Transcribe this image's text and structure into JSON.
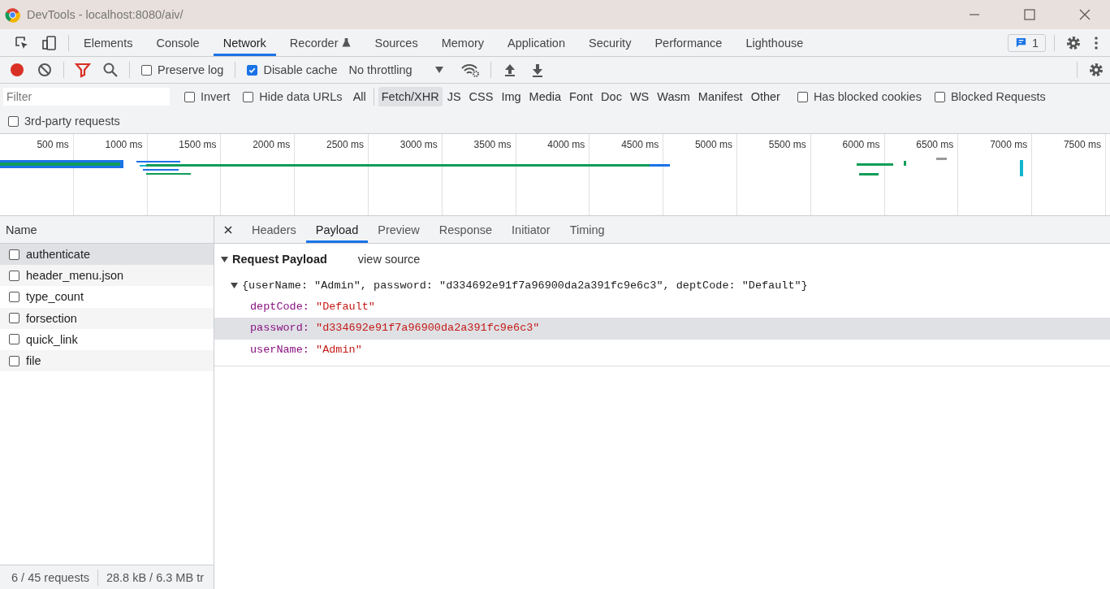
{
  "window": {
    "title": "DevTools - localhost:8080/aiv/"
  },
  "main_tabs": [
    {
      "label": "Elements",
      "selected": false,
      "experimental": false
    },
    {
      "label": "Console",
      "selected": false,
      "experimental": false
    },
    {
      "label": "Network",
      "selected": true,
      "experimental": false
    },
    {
      "label": "Recorder",
      "selected": false,
      "experimental": true
    },
    {
      "label": "Sources",
      "selected": false,
      "experimental": false
    },
    {
      "label": "Memory",
      "selected": false,
      "experimental": false
    },
    {
      "label": "Application",
      "selected": false,
      "experimental": false
    },
    {
      "label": "Security",
      "selected": false,
      "experimental": false
    },
    {
      "label": "Performance",
      "selected": false,
      "experimental": false
    },
    {
      "label": "Lighthouse",
      "selected": false,
      "experimental": false
    }
  ],
  "issues_badge": "1",
  "toolbar": {
    "recording": true,
    "preserve_log": {
      "label": "Preserve log",
      "checked": false
    },
    "disable_cache": {
      "label": "Disable cache",
      "checked": true
    },
    "throttling": "No throttling"
  },
  "filter": {
    "placeholder": "Filter",
    "invert": {
      "label": "Invert",
      "checked": false
    },
    "hide_data_urls": {
      "label": "Hide data URLs",
      "checked": false
    },
    "types": [
      {
        "label": "All",
        "selected": false
      },
      {
        "label": "Fetch/XHR",
        "selected": true
      },
      {
        "label": "JS",
        "selected": false
      },
      {
        "label": "CSS",
        "selected": false
      },
      {
        "label": "Img",
        "selected": false
      },
      {
        "label": "Media",
        "selected": false
      },
      {
        "label": "Font",
        "selected": false
      },
      {
        "label": "Doc",
        "selected": false
      },
      {
        "label": "WS",
        "selected": false
      },
      {
        "label": "Wasm",
        "selected": false
      },
      {
        "label": "Manifest",
        "selected": false
      },
      {
        "label": "Other",
        "selected": false
      }
    ],
    "has_blocked_cookies": {
      "label": "Has blocked cookies",
      "checked": false
    },
    "blocked_requests": {
      "label": "Blocked Requests",
      "checked": false
    },
    "third_party": {
      "label": "3rd-party requests",
      "checked": false
    }
  },
  "timeline": {
    "ticks": [
      "500 ms",
      "1000 ms",
      "1500 ms",
      "2000 ms",
      "2500 ms",
      "3000 ms",
      "3500 ms",
      "4000 ms",
      "4500 ms",
      "5000 ms",
      "5500 ms",
      "6000 ms",
      "6500 ms",
      "7000 ms",
      "7500 ms"
    ]
  },
  "requests": {
    "column": "Name",
    "rows": [
      {
        "name": "authenticate",
        "selected": true,
        "checked": false
      },
      {
        "name": "header_menu.json",
        "selected": false,
        "checked": false
      },
      {
        "name": "type_count",
        "selected": false,
        "checked": false
      },
      {
        "name": "forsection",
        "selected": false,
        "checked": false
      },
      {
        "name": "quick_link",
        "selected": false,
        "checked": false
      },
      {
        "name": "file",
        "selected": false,
        "checked": false
      }
    ]
  },
  "detail_tabs": [
    {
      "label": "Headers",
      "selected": false
    },
    {
      "label": "Payload",
      "selected": true
    },
    {
      "label": "Preview",
      "selected": false
    },
    {
      "label": "Response",
      "selected": false
    },
    {
      "label": "Initiator",
      "selected": false
    },
    {
      "label": "Timing",
      "selected": false
    }
  ],
  "payload": {
    "title": "Request Payload",
    "expanded": true,
    "view_source": "view source",
    "summary": "{userName: \"Admin\", password: \"d334692e91f7a96900da2a391fc9e6c3\", deptCode: \"Default\"}",
    "properties": [
      {
        "key": "deptCode:",
        "value": "\"Default\"",
        "selected": false
      },
      {
        "key": "password:",
        "value": "\"d334692e91f7a96900da2a391fc9e6c3\"",
        "selected": true
      },
      {
        "key": "userName:",
        "value": "\"Admin\"",
        "selected": false
      }
    ]
  },
  "status_bar": [
    "6 / 45 requests",
    "28.8 kB / 6.3 MB tr"
  ]
}
